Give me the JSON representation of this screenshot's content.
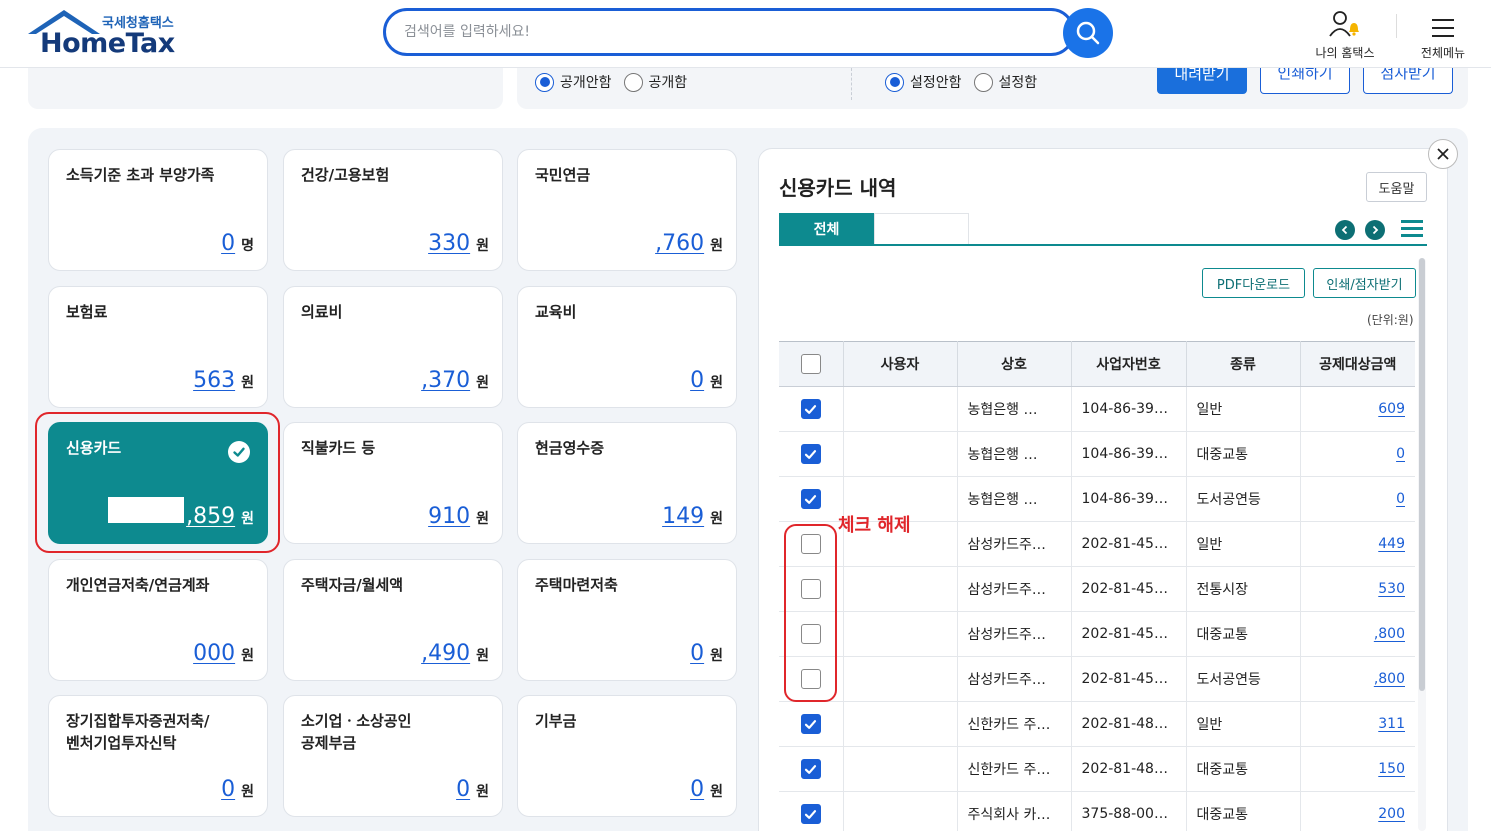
{
  "header": {
    "logo_sub": "국세청홈택스",
    "logo_main": "HomeTax",
    "search_placeholder": "검색어를 입력하세요!",
    "my_hometax": "나의 홈택스",
    "all_menu": "전체메뉴"
  },
  "filters": {
    "group1": [
      {
        "label": "공개안함",
        "selected": true
      },
      {
        "label": "공개함",
        "selected": false
      }
    ],
    "group2": [
      {
        "label": "설정안함",
        "selected": true
      },
      {
        "label": "설정함",
        "selected": false
      }
    ],
    "buttons": [
      "내려받기",
      "인쇄하기",
      "점자받기"
    ]
  },
  "cards": [
    {
      "title": "소득기준 초과 부양가족",
      "value": "0",
      "unit": "명"
    },
    {
      "title": "건강/고용보험",
      "value": "330",
      "unit": "원"
    },
    {
      "title": "국민연금",
      "value": ",760",
      "unit": "원"
    },
    {
      "title": "보험료",
      "value": "563",
      "unit": "원"
    },
    {
      "title": "의료비",
      "value": ",370",
      "unit": "원"
    },
    {
      "title": "교육비",
      "value": "0",
      "unit": "원"
    },
    {
      "title": "신용카드",
      "value": ",859",
      "unit": "원",
      "active": true
    },
    {
      "title": "직불카드 등",
      "value": "910",
      "unit": "원"
    },
    {
      "title": "현금영수증",
      "value": "149",
      "unit": "원"
    },
    {
      "title": "개인연금저축/연금계좌",
      "value": "000",
      "unit": "원"
    },
    {
      "title": "주택자금/월세액",
      "value": ",490",
      "unit": "원"
    },
    {
      "title": "주택마련저축",
      "value": "0",
      "unit": "원"
    },
    {
      "title": "장기집합투자증권저축/\n벤처기업투자신탁",
      "value": "0",
      "unit": "원"
    },
    {
      "title": "소기업ㆍ소상공인\n공제부금",
      "value": "0",
      "unit": "원"
    },
    {
      "title": "기부금",
      "value": "0",
      "unit": "원"
    }
  ],
  "panel": {
    "title": "신용카드 내역",
    "help": "도움말",
    "tab_all": "전체",
    "pdf_download": "PDF다운로드",
    "print_braille": "인쇄/점자받기",
    "unit_note": "(단위:원)",
    "annotation": "체크 해제",
    "columns": [
      "사용자",
      "상호",
      "사업자번호",
      "종류",
      "공제대상금액"
    ],
    "rows": [
      {
        "checked": true,
        "user": "",
        "name": "농협은행   …",
        "biz": "104-86-39…",
        "kind": "일반",
        "amount": "609"
      },
      {
        "checked": true,
        "user": "",
        "name": "농협은행   …",
        "biz": "104-86-39…",
        "kind": "대중교통",
        "amount": "0"
      },
      {
        "checked": true,
        "user": "",
        "name": "농협은행   …",
        "biz": "104-86-39…",
        "kind": "도서공연등",
        "amount": "0"
      },
      {
        "checked": false,
        "user": "",
        "name": "삼성카드주…",
        "biz": "202-81-45…",
        "kind": "일반",
        "amount": "449"
      },
      {
        "checked": false,
        "user": "",
        "name": "삼성카드주…",
        "biz": "202-81-45…",
        "kind": "전통시장",
        "amount": "530"
      },
      {
        "checked": false,
        "user": "",
        "name": "삼성카드주…",
        "biz": "202-81-45…",
        "kind": "대중교통",
        "amount": ",800"
      },
      {
        "checked": false,
        "user": "",
        "name": "삼성카드주…",
        "biz": "202-81-45…",
        "kind": "도서공연등",
        "amount": ",800"
      },
      {
        "checked": true,
        "user": "",
        "name": "신한카드 주…",
        "biz": "202-81-48…",
        "kind": "일반",
        "amount": "311"
      },
      {
        "checked": true,
        "user": "",
        "name": "신한카드 주…",
        "biz": "202-81-48…",
        "kind": "대중교통",
        "amount": "150"
      },
      {
        "checked": true,
        "user": "",
        "name": "주식회사 카…",
        "biz": "375-88-00…",
        "kind": "대중교통",
        "amount": "200"
      }
    ]
  },
  "colors": {
    "primary_blue": "#1a5ed6",
    "teal": "#0d8a8f",
    "highlight_red": "#e0262b"
  }
}
